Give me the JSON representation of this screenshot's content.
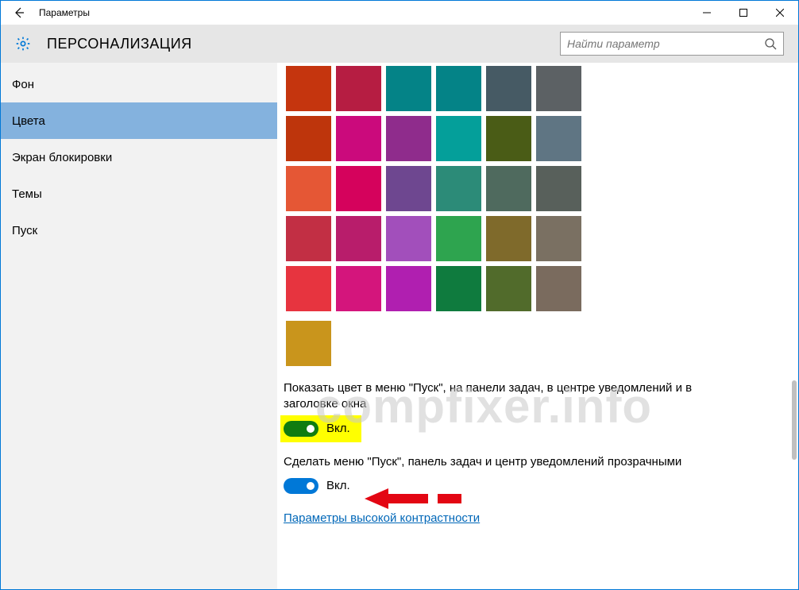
{
  "window": {
    "title": "Параметры"
  },
  "header": {
    "heading": "ПЕРСОНАЛИЗАЦИЯ",
    "search_placeholder": "Найти параметр"
  },
  "sidebar": {
    "items": [
      {
        "label": "Фон",
        "active": false
      },
      {
        "label": "Цвета",
        "active": true
      },
      {
        "label": "Экран блокировки",
        "active": false
      },
      {
        "label": "Темы",
        "active": false
      },
      {
        "label": "Пуск",
        "active": false
      }
    ]
  },
  "content": {
    "color_rows": [
      [
        "#c5350e",
        "#b61d42",
        "#048387",
        "#048387",
        "#465a64",
        "#5c6164"
      ],
      [
        "#be350c",
        "#cb0a7c",
        "#8f2c8c",
        "#049f9a",
        "#4a5c16",
        "#5f7583"
      ],
      [
        "#e55735",
        "#d5025c",
        "#6e4790",
        "#2c8b78",
        "#4f6a5e",
        "#58605b"
      ],
      [
        "#c22f44",
        "#b81d6b",
        "#a24fbb",
        "#2ea44f",
        "#7f6a2b",
        "#7a7062"
      ],
      [
        "#e7343f",
        "#d4157c",
        "#b01fb0",
        "#0f7b3e",
        "#516b2b",
        "#7a6b5e"
      ]
    ],
    "extra_swatch": "#c9951c",
    "toggle1_text": "Показать цвет в меню \"Пуск\", на панели задач, в центре уведомлений и в заголовке окна",
    "toggle1_state": "Вкл.",
    "toggle2_text": "Сделать меню \"Пуск\", панель задач и центр уведомлений прозрачными",
    "toggle2_state": "Вкл.",
    "link_text": "Параметры высокой контрастности"
  },
  "watermark": "compfixer.info"
}
